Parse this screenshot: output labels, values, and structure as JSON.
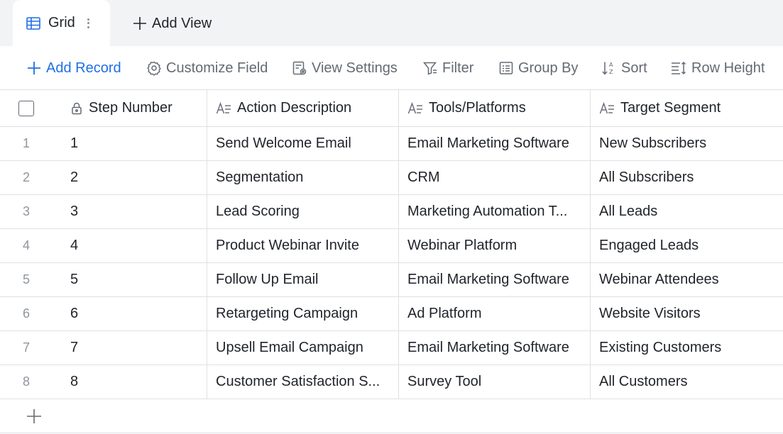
{
  "tabs": {
    "active_view": {
      "label": "Grid",
      "icon": "table-icon"
    },
    "add_view": {
      "label": "Add View",
      "icon": "plus-icon"
    }
  },
  "toolbar": {
    "add_record": {
      "label": "Add Record",
      "icon": "plus-icon"
    },
    "customize_field": {
      "label": "Customize Field",
      "icon": "gear-icon"
    },
    "view_settings": {
      "label": "View Settings",
      "icon": "document-settings-icon"
    },
    "filter": {
      "label": "Filter",
      "icon": "filter-icon"
    },
    "group_by": {
      "label": "Group By",
      "icon": "group-list-icon"
    },
    "sort": {
      "label": "Sort",
      "icon": "sort-az-icon"
    },
    "row_height": {
      "label": "Row Height",
      "icon": "row-height-icon"
    }
  },
  "table": {
    "columns": [
      {
        "label": "Step Number",
        "icon": "lock-icon"
      },
      {
        "label": "Action Description",
        "icon": "text-field-icon"
      },
      {
        "label": "Tools/Platforms",
        "icon": "text-field-icon"
      },
      {
        "label": "Target Segment",
        "icon": "text-field-icon"
      }
    ],
    "rows": [
      {
        "index": "1",
        "step": "1",
        "action": "Send Welcome Email",
        "tools": "Email Marketing Software",
        "target": "New Subscribers"
      },
      {
        "index": "2",
        "step": "2",
        "action": "Segmentation",
        "tools": "CRM",
        "target": "All Subscribers"
      },
      {
        "index": "3",
        "step": "3",
        "action": "Lead Scoring",
        "tools": "Marketing Automation T...",
        "target": "All Leads"
      },
      {
        "index": "4",
        "step": "4",
        "action": "Product Webinar Invite",
        "tools": "Webinar Platform",
        "target": "Engaged Leads"
      },
      {
        "index": "5",
        "step": "5",
        "action": "Follow Up Email",
        "tools": "Email Marketing Software",
        "target": "Webinar Attendees"
      },
      {
        "index": "6",
        "step": "6",
        "action": "Retargeting Campaign",
        "tools": "Ad Platform",
        "target": "Website Visitors"
      },
      {
        "index": "7",
        "step": "7",
        "action": "Upsell Email Campaign",
        "tools": "Email Marketing Software",
        "target": "Existing Customers"
      },
      {
        "index": "8",
        "step": "8",
        "action": "Customer Satisfaction S...",
        "tools": "Survey Tool",
        "target": "All Customers"
      }
    ],
    "add_row_icon": "plus-icon"
  },
  "colors": {
    "accent": "#1f6fe5",
    "tab_bar_bg": "#f2f3f5",
    "border": "#dee0e3",
    "muted_text": "#646a73",
    "index_text": "#8f959e"
  }
}
